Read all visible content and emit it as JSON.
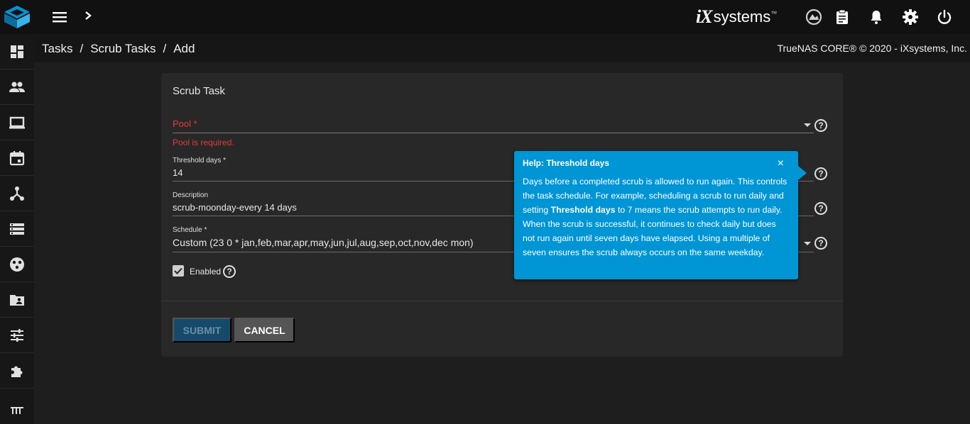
{
  "header": {
    "brand_ix": "iX",
    "brand_systems": "systems",
    "brand_tm": "™"
  },
  "breadcrumb": [
    "Tasks",
    "Scrub Tasks",
    "Add"
  ],
  "breadcrumb_sep": "/",
  "copyright": "TrueNAS CORE® © 2020 - iXsystems, Inc.",
  "form": {
    "title": "Scrub Task",
    "pool": {
      "label": "Pool *",
      "error": "Pool is required."
    },
    "threshold": {
      "label": "Threshold days *",
      "value": "14"
    },
    "description": {
      "label": "Description",
      "value": "scrub-moonday-every 14 days"
    },
    "schedule": {
      "label": "Schedule *",
      "value": "Custom (23 0 * jan,feb,mar,apr,may,jun,jul,aug,sep,oct,nov,dec mon)"
    },
    "enabled": {
      "label": "Enabled",
      "checked": true
    },
    "help_glyph": "?",
    "submit_label": "SUBMIT",
    "cancel_label": "CANCEL"
  },
  "tooltip": {
    "title": "Help: Threshold days",
    "close": "×",
    "body_before": "Days before a completed scrub is allowed to run again. This controls the task schedule. For example, scheduling a scrub to run daily and setting ",
    "body_bold": "Threshold days",
    "body_after": " to 7 means the scrub attempts to run daily. When the scrub is successful, it continues to check daily but does not run again until seven days have elapsed. Using a multiple of seven ensures the scrub always occurs on the same weekday."
  },
  "sidebar": {
    "icons": [
      "dashboard-icon",
      "accounts-icon",
      "system-icon",
      "tasks-icon",
      "network-icon",
      "storage-icon",
      "directory-services-icon",
      "sharing-icon",
      "services-icon",
      "plugins-icon",
      "jails-icon"
    ]
  },
  "colors": {
    "accent": "#0095d5",
    "error": "#e33b3b",
    "topbar": "#111111",
    "card": "#282828"
  }
}
